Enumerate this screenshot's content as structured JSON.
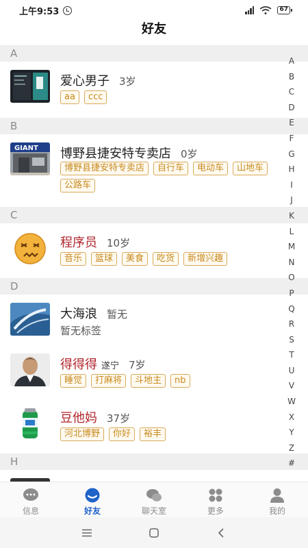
{
  "status": {
    "time": "上午9:53",
    "battery": "67"
  },
  "title": "好友",
  "sections": {
    "a": "A",
    "b": "B",
    "c": "C",
    "d": "D",
    "h": "H"
  },
  "friends": [
    {
      "name": "爱心男子",
      "age": "3岁",
      "tags": [
        "aa",
        "ccc"
      ]
    },
    {
      "name": "博野县捷安特专卖店",
      "age": "0岁",
      "tags": [
        "博野县捷安特专卖店",
        "自行车",
        "电动车",
        "山地车",
        "公路车"
      ]
    },
    {
      "name": "程序员",
      "age": "10岁",
      "tags": [
        "音乐",
        "篮球",
        "美食",
        "吃货",
        "新增兴趣"
      ]
    },
    {
      "name": "大海浪",
      "age": "暂无",
      "no_tags": "暂无标签"
    },
    {
      "name": "得得得",
      "location": "遂宁",
      "age": "7岁",
      "tags": [
        "睡觉",
        "打麻将",
        "斗地主",
        "nb"
      ]
    },
    {
      "name": "豆他妈",
      "age": "37岁",
      "tags": [
        "河北博野",
        "你好",
        "裕丰"
      ]
    }
  ],
  "index_letters": [
    "A",
    "B",
    "C",
    "D",
    "E",
    "F",
    "G",
    "H",
    "I",
    "J",
    "K",
    "L",
    "M",
    "N",
    "O",
    "P",
    "Q",
    "R",
    "S",
    "T",
    "U",
    "V",
    "W",
    "X",
    "Y",
    "Z",
    "#"
  ],
  "tabs": [
    {
      "label": "信息",
      "icon": "chat-bubble-icon"
    },
    {
      "label": "好友",
      "icon": "friends-icon"
    },
    {
      "label": "聊天室",
      "icon": "chatroom-icon"
    },
    {
      "label": "更多",
      "icon": "grid-icon"
    },
    {
      "label": "我的",
      "icon": "person-icon"
    }
  ],
  "colors": {
    "accent": "#1f63c9",
    "tag": "#c78a1e",
    "name_red": "#b0242b"
  }
}
